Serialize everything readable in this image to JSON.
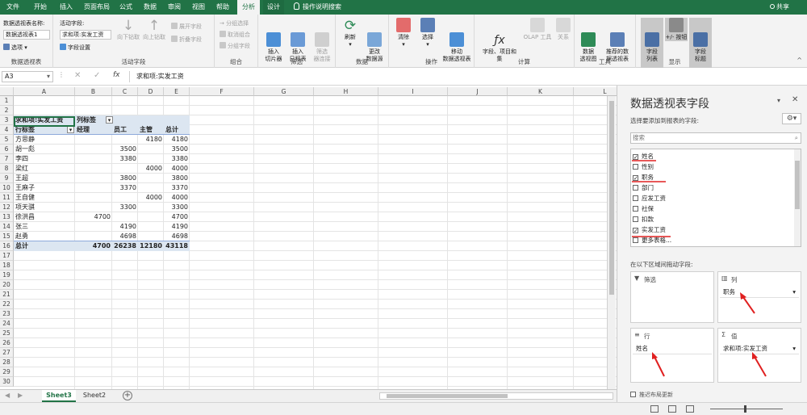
{
  "tabs": [
    "文件",
    "开始",
    "插入",
    "页面布局",
    "公式",
    "数据",
    "审阅",
    "视图",
    "帮助",
    "分析",
    "设计"
  ],
  "tell_me": "操作说明搜索",
  "share": "共享",
  "ribbon": {
    "pivot_group": {
      "name_label": "数据透视表名称:",
      "name_value": "数据透视表1",
      "options": "选项",
      "label": "数据透视表"
    },
    "active_field_group": {
      "label_title": "活动字段:",
      "value": "求和项:实发工资",
      "settings": "字段设置",
      "drill_down": "向下钻取",
      "drill_up": "向上钻取",
      "expand": "展开字段",
      "collapse": "折叠字段",
      "label": "活动字段"
    },
    "group_group": {
      "sel": "分组选择",
      "ungroup": "取消组合",
      "field": "分组字段",
      "label": "组合"
    },
    "filter_group": {
      "slicer": "插入\n切片器",
      "timeline": "插入\n日程表",
      "connections": "筛选\n器连接",
      "label": "筛选"
    },
    "data_group": {
      "refresh": "刷新",
      "change_source": "更改\n数据源",
      "label": "数据"
    },
    "actions_group": {
      "clear": "清除",
      "select": "选择",
      "move": "移动\n数据透视表",
      "label": "操作"
    },
    "calc_group": {
      "fields": "字段、项目和\n集",
      "olap": "OLAP 工具",
      "relations": "关系",
      "label": "计算"
    },
    "tools_group": {
      "chart": "数据\n透视图",
      "recommended": "推荐的数\n据透视表",
      "label": "工具"
    },
    "show_group": {
      "field_list": "字段\n列表",
      "buttons": "+/- 按钮",
      "headers": "字段\n标题",
      "label": "显示"
    }
  },
  "formula_bar": {
    "name_box": "A3",
    "fx": "fx",
    "formula": "求和项:实发工资"
  },
  "columns": [
    "A",
    "B",
    "C",
    "D",
    "E",
    "F",
    "G",
    "H",
    "I",
    "J",
    "K",
    "L"
  ],
  "pivot": {
    "title": "求和项:实发工资",
    "col_label": "列标签",
    "row_label": "行标签",
    "headers": [
      "经理",
      "员工",
      "主管",
      "总计"
    ],
    "rows": [
      {
        "name": "方思静",
        "values": [
          "",
          "",
          "4180",
          "4180"
        ]
      },
      {
        "name": "胡一彪",
        "values": [
          "",
          "3500",
          "",
          "3500"
        ]
      },
      {
        "name": "李四",
        "values": [
          "",
          "3380",
          "",
          "3380"
        ]
      },
      {
        "name": "梁红",
        "values": [
          "",
          "",
          "4000",
          "4000"
        ]
      },
      {
        "name": "王超",
        "values": [
          "",
          "3800",
          "",
          "3800"
        ]
      },
      {
        "name": "王麻子",
        "values": [
          "",
          "3370",
          "",
          "3370"
        ]
      },
      {
        "name": "王自健",
        "values": [
          "",
          "",
          "4000",
          "4000"
        ]
      },
      {
        "name": "项天骐",
        "values": [
          "",
          "3300",
          "",
          "3300"
        ]
      },
      {
        "name": "徐洪昌",
        "values": [
          "4700",
          "",
          "",
          "4700"
        ]
      },
      {
        "name": "张三",
        "values": [
          "",
          "4190",
          "",
          "4190"
        ]
      },
      {
        "name": "赵勇",
        "values": [
          "",
          "4698",
          "",
          "4698"
        ]
      }
    ],
    "total": {
      "name": "总计",
      "values": [
        "4700",
        "26238",
        "12180",
        "43118"
      ]
    }
  },
  "sheets": [
    "Sheet3",
    "Sheet2"
  ],
  "pane": {
    "title": "数据透视表字段",
    "subtitle": "选择要添加到报表的字段:",
    "search_placeholder": "搜索",
    "fields": [
      {
        "label": "姓名",
        "checked": true
      },
      {
        "label": "性别",
        "checked": false
      },
      {
        "label": "职务",
        "checked": true
      },
      {
        "label": "部门",
        "checked": false
      },
      {
        "label": "应发工资",
        "checked": false
      },
      {
        "label": "社保",
        "checked": false
      },
      {
        "label": "扣款",
        "checked": false
      },
      {
        "label": "实发工资",
        "checked": true
      },
      {
        "label": "更多表格...",
        "checked": false
      }
    ],
    "drag_label": "在以下区域间拖动字段:",
    "areas": {
      "filter": "筛选",
      "columns": "列",
      "rows": "行",
      "values": "值",
      "columns_item": "职务",
      "rows_item": "姓名",
      "values_item": "求和项:实发工资"
    },
    "defer": "推迟布局更新"
  },
  "colors": {
    "excel_green": "#217346",
    "pivot_header": "#dce6f1",
    "arrow": "#e02020"
  }
}
